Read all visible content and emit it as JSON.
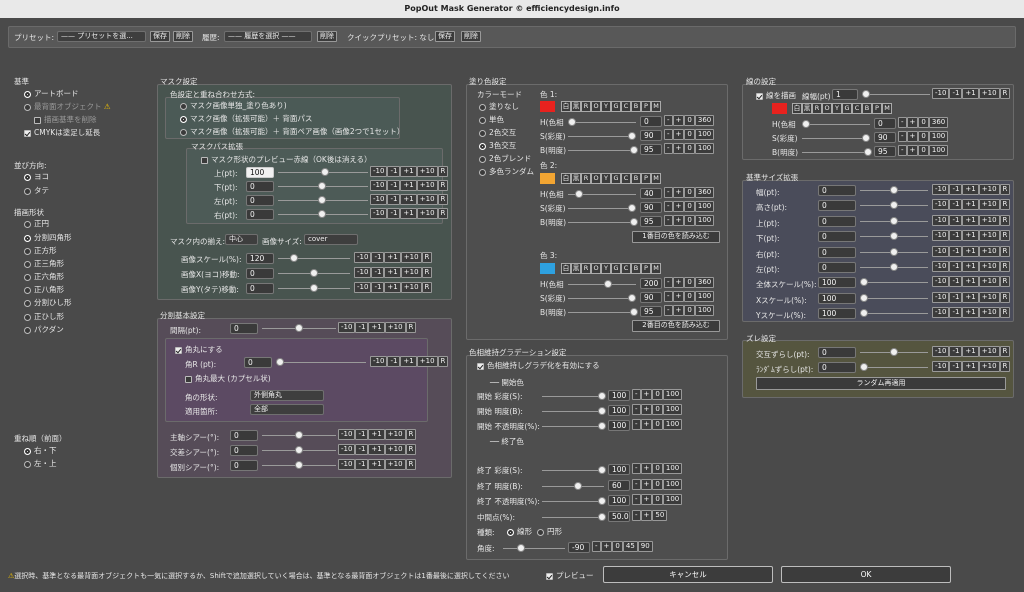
{
  "window": {
    "title": "PopOut Mask Generator © efficiencydesign.info"
  },
  "toolbar": {
    "preset_label": "プリセット:",
    "preset_value": "—— プリセットを選...",
    "save": "保存",
    "delete": "削除",
    "history_label": "履歴:",
    "history_value": "—— 履歴を選択 ——",
    "history_delete": "削除",
    "quick_label": "クイックプリセット: なし",
    "quick_save": "保存",
    "quick_delete": "削除"
  },
  "base": {
    "title": "基準",
    "opt1": "アートボード",
    "opt2": "最背面オブジェクト",
    "opt3": "描画基準を削除",
    "cmyk": "CMYKは塗足し延長"
  },
  "order": {
    "title": "並び方向:",
    "opt1": "ヨコ",
    "opt2": "タテ"
  },
  "shape": {
    "title": "描画形状",
    "items": [
      "正円",
      "分割四角形",
      "正方形",
      "正三角形",
      "正六角形",
      "正八角形",
      "分割ひし形",
      "正ひし形",
      "パクダン"
    ]
  },
  "stack": {
    "title": "重ね順（前面）",
    "opt1": "右・下",
    "opt2": "左・上"
  },
  "mask": {
    "title": "マスク設定",
    "combo_title": "色設定と重ね合わせ方式:",
    "combo1": "マスク画像単独_塗り色あり)",
    "combo2": "マスク画像（拡張可能）＋ 背面パス",
    "combo3": "マスク画像（拡張可能）＋ 背面ペア画像（画像2つで1セット）",
    "ext_title": "マスクパス拡張",
    "preview": "マスク形状のプレビュー赤線（OK後は消える）",
    "top_label": "上(pt):",
    "top_value": "100",
    "bottom_label": "下(pt):",
    "bottom_value": "0",
    "left_label": "左(pt):",
    "left_value": "0",
    "right_label": "右(pt):",
    "right_value": "0",
    "align_label": "マスク内の揃え:",
    "align_value": "中心",
    "size_label": "画像サイズ:",
    "size_value": "cover",
    "scale_label": "画像スケール(%):",
    "scale_value": "120",
    "x_label": "画像X(ヨコ)移動:",
    "x_value": "0",
    "y_label": "画像Y(タテ)移動:",
    "y_value": "0"
  },
  "steps": {
    "m10": "-10",
    "m1": "-1",
    "p1": "+1",
    "p10": "+10",
    "r": "R"
  },
  "divide": {
    "title": "分割基本設定",
    "gap_label": "間隔(pt):",
    "gap_value": "0",
    "round": "角丸にする",
    "radius_label": "角R (pt):",
    "radius_value": "0",
    "max": "角丸最大 (カプセル状)",
    "corner_label": "角の形状:",
    "corner_value": "外側角丸",
    "apply_label": "適用箇所:",
    "apply_value": "全部",
    "shear1_label": "主軸シアー(°):",
    "shear1_value": "0",
    "shear2_label": "交差シアー(°):",
    "shear2_value": "0",
    "shear3_label": "個別シアー(°):",
    "shear3_value": "0"
  },
  "fill": {
    "title": "塗り色設定",
    "mode_title": "カラーモード",
    "modes": [
      "塗りなし",
      "単色",
      "2色交互",
      "3色交互",
      "2色ブレンド",
      "多色ランダム"
    ],
    "color1": "色 1:",
    "color2": "色 2:",
    "color3": "色 3:",
    "load1": "1番目の色を読み込む",
    "load2": "2番目の色を読み込む",
    "h": "H(色相",
    "s": "S(彩度)",
    "b": "B(明度)",
    "h1": "0",
    "s1": "90",
    "b1": "95",
    "h2": "40",
    "s2": "90",
    "b2": "95",
    "h3": "200",
    "s3": "90",
    "b3": "95",
    "max360": "360",
    "max100": "100",
    "minus": "-",
    "plus": "+",
    "zero": "0"
  },
  "palette": [
    "白",
    "黒",
    "R",
    "O",
    "Y",
    "G",
    "C",
    "B",
    "P",
    "M"
  ],
  "colors": {
    "c1": "#e8221e",
    "c2": "#f2a532",
    "c3": "#2ea1e0"
  },
  "grad": {
    "title": "色相維持グラデーション設定",
    "enable": "色相維持しグラデ化を有効にする",
    "start": "開始色",
    "start_s_label": "開始 彩度(S):",
    "start_s": "100",
    "start_b_label": "開始 明度(B):",
    "start_b": "100",
    "start_o_label": "開始 不透明度(%):",
    "start_o": "100",
    "end": "終了色",
    "end_s_label": "終了 彩度(S):",
    "end_s": "100",
    "end_b_label": "終了 明度(B):",
    "end_b": "60",
    "end_o_label": "終了 不透明度(%):",
    "end_o": "100",
    "mid_label": "中間点(%):",
    "mid": "50.0",
    "mid_max": "50",
    "type_label": "種類:",
    "linear": "線形",
    "radial": "円形",
    "angle_label": "角度:",
    "angle": "-90",
    "a45": "45",
    "a90": "90"
  },
  "line": {
    "title": "線の設定",
    "draw": "線を描画",
    "width_label": "線幅(pt)",
    "width_value": "1",
    "color": "#e8221e",
    "h": "0",
    "s": "90",
    "b": "95"
  },
  "ext": {
    "title": "基準サイズ拡張",
    "rows": [
      {
        "label": "幅(pt):",
        "value": "0"
      },
      {
        "label": "高さ(pt):",
        "value": "0"
      },
      {
        "label": "上(pt):",
        "value": "0"
      },
      {
        "label": "下(pt):",
        "value": "0"
      },
      {
        "label": "右(pt):",
        "value": "0"
      },
      {
        "label": "左(pt):",
        "value": "0"
      },
      {
        "label": "全体スケール(%):",
        "value": "100"
      },
      {
        "label": "Xスケール(%):",
        "value": "100"
      },
      {
        "label": "Yスケール(%):",
        "value": "100"
      }
    ]
  },
  "shift": {
    "title": "ズレ設定",
    "alt_label": "交互ずらし(pt):",
    "alt_value": "0",
    "rand_label": "ﾗﾝﾀﾞﾑずらし(pt):",
    "rand_value": "0",
    "reapply": "ランダム再適用"
  },
  "footer": {
    "note": "選択時、基準となる最背面オブジェクトも一気に選択するか、Shiftで追加選択していく場合は、基準となる最背面オブジェクトは1番最後に選択してください",
    "preview": "プレビュー",
    "cancel": "キャンセル",
    "ok": "OK"
  }
}
